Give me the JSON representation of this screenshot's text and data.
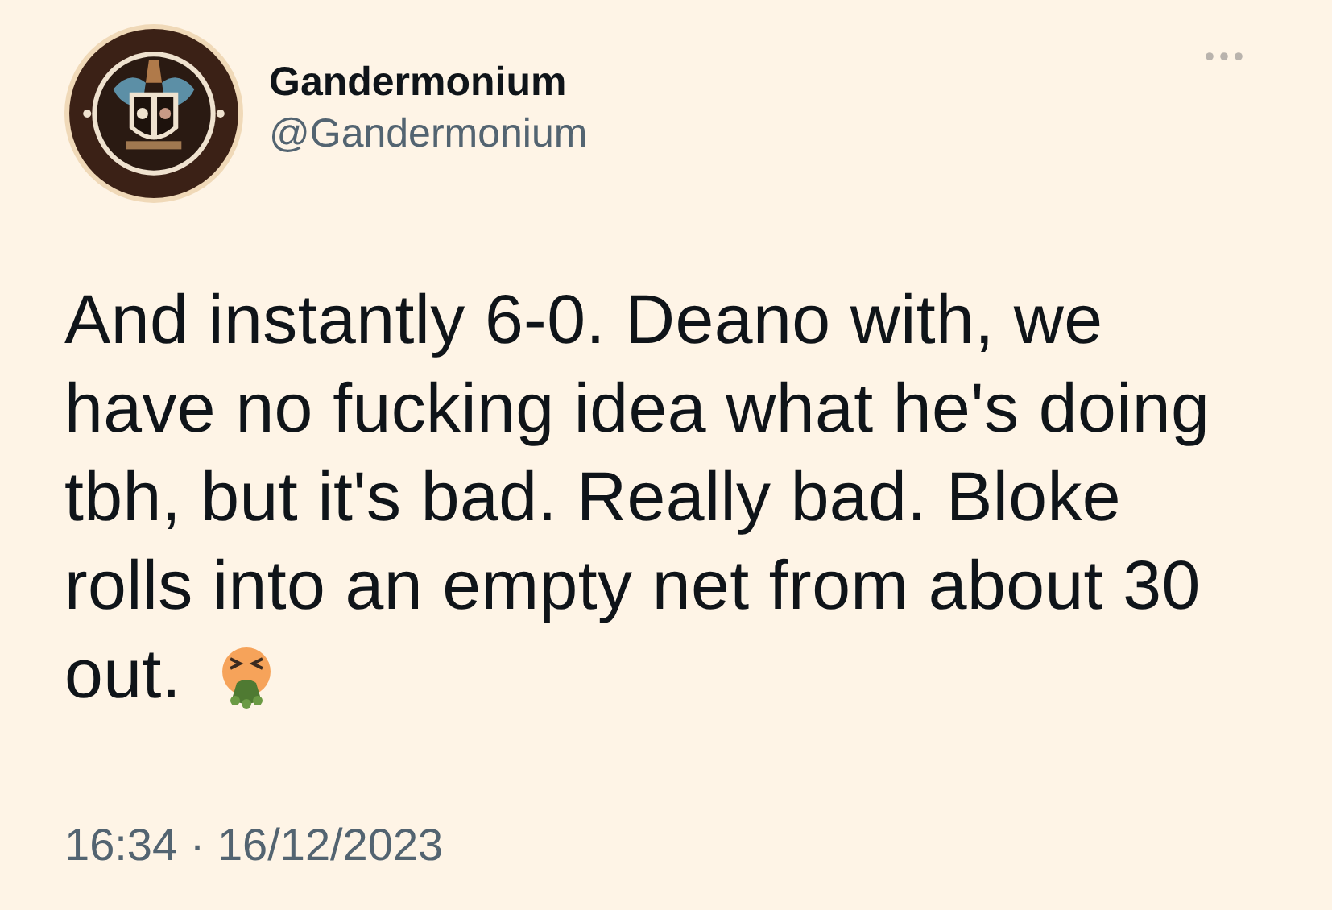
{
  "author": {
    "name": "Gandermonium",
    "handle": "@Gandermonium"
  },
  "tweet": {
    "lines": [
      "And instantly 6-0. Deano with, we",
      "have no fucking idea what he's doing",
      "tbh, but it's bad. Really bad. Bloke",
      "rolls into an empty net from about 30",
      "out."
    ]
  },
  "timestamp": "16:34 · 16/12/2023"
}
